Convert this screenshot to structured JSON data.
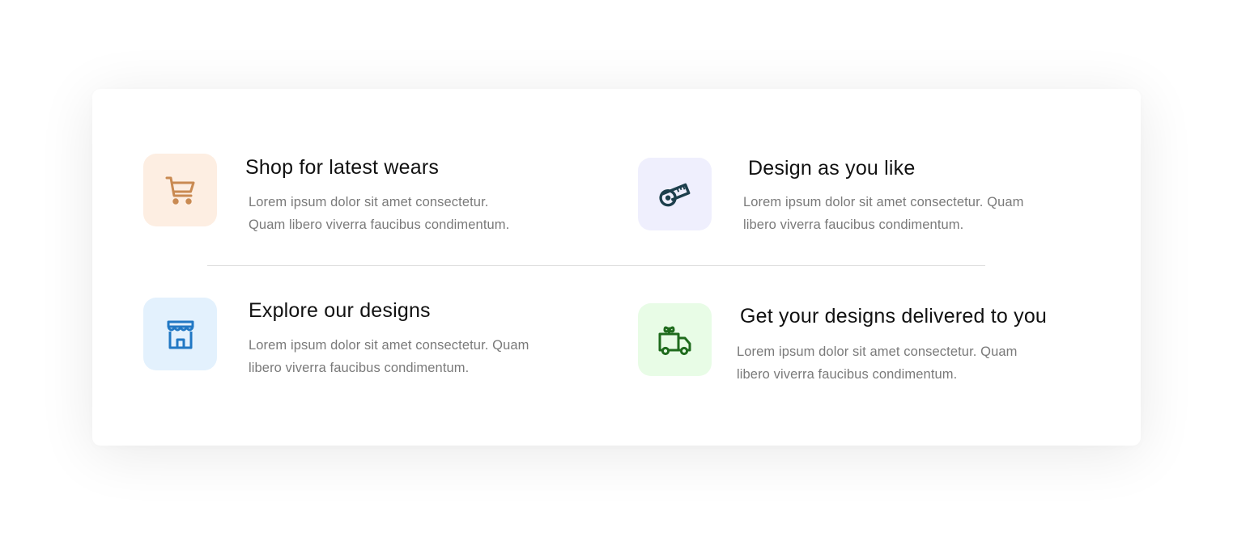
{
  "features": [
    {
      "title": "Shop for latest wears",
      "description": "Lorem ipsum dolor sit amet consectetur. Quam libero viverra faucibus condimentum.",
      "icon": "shopping-cart-icon",
      "icon_color": "#c98a52",
      "bg_color": "#fdeee2"
    },
    {
      "title": "Design as you like",
      "description": "Lorem ipsum dolor sit amet consectetur. Quam libero viverra faucibus condimentum.",
      "icon": "measuring-tape-icon",
      "icon_color": "#1d3f4c",
      "bg_color": "#efeffd"
    },
    {
      "title": "Explore our designs",
      "description": "Lorem ipsum dolor sit amet consectetur. Quam libero viverra faucibus condimentum.",
      "icon": "storefront-icon",
      "icon_color": "#2178c4",
      "bg_color": "#e3f1fd"
    },
    {
      "title": "Get your designs delivered to you",
      "description": "Lorem ipsum dolor sit amet consectetur. Quam libero viverra faucibus condimentum.",
      "icon": "delivery-truck-icon",
      "icon_color": "#1f6b1d",
      "bg_color": "#e8fce6"
    }
  ]
}
